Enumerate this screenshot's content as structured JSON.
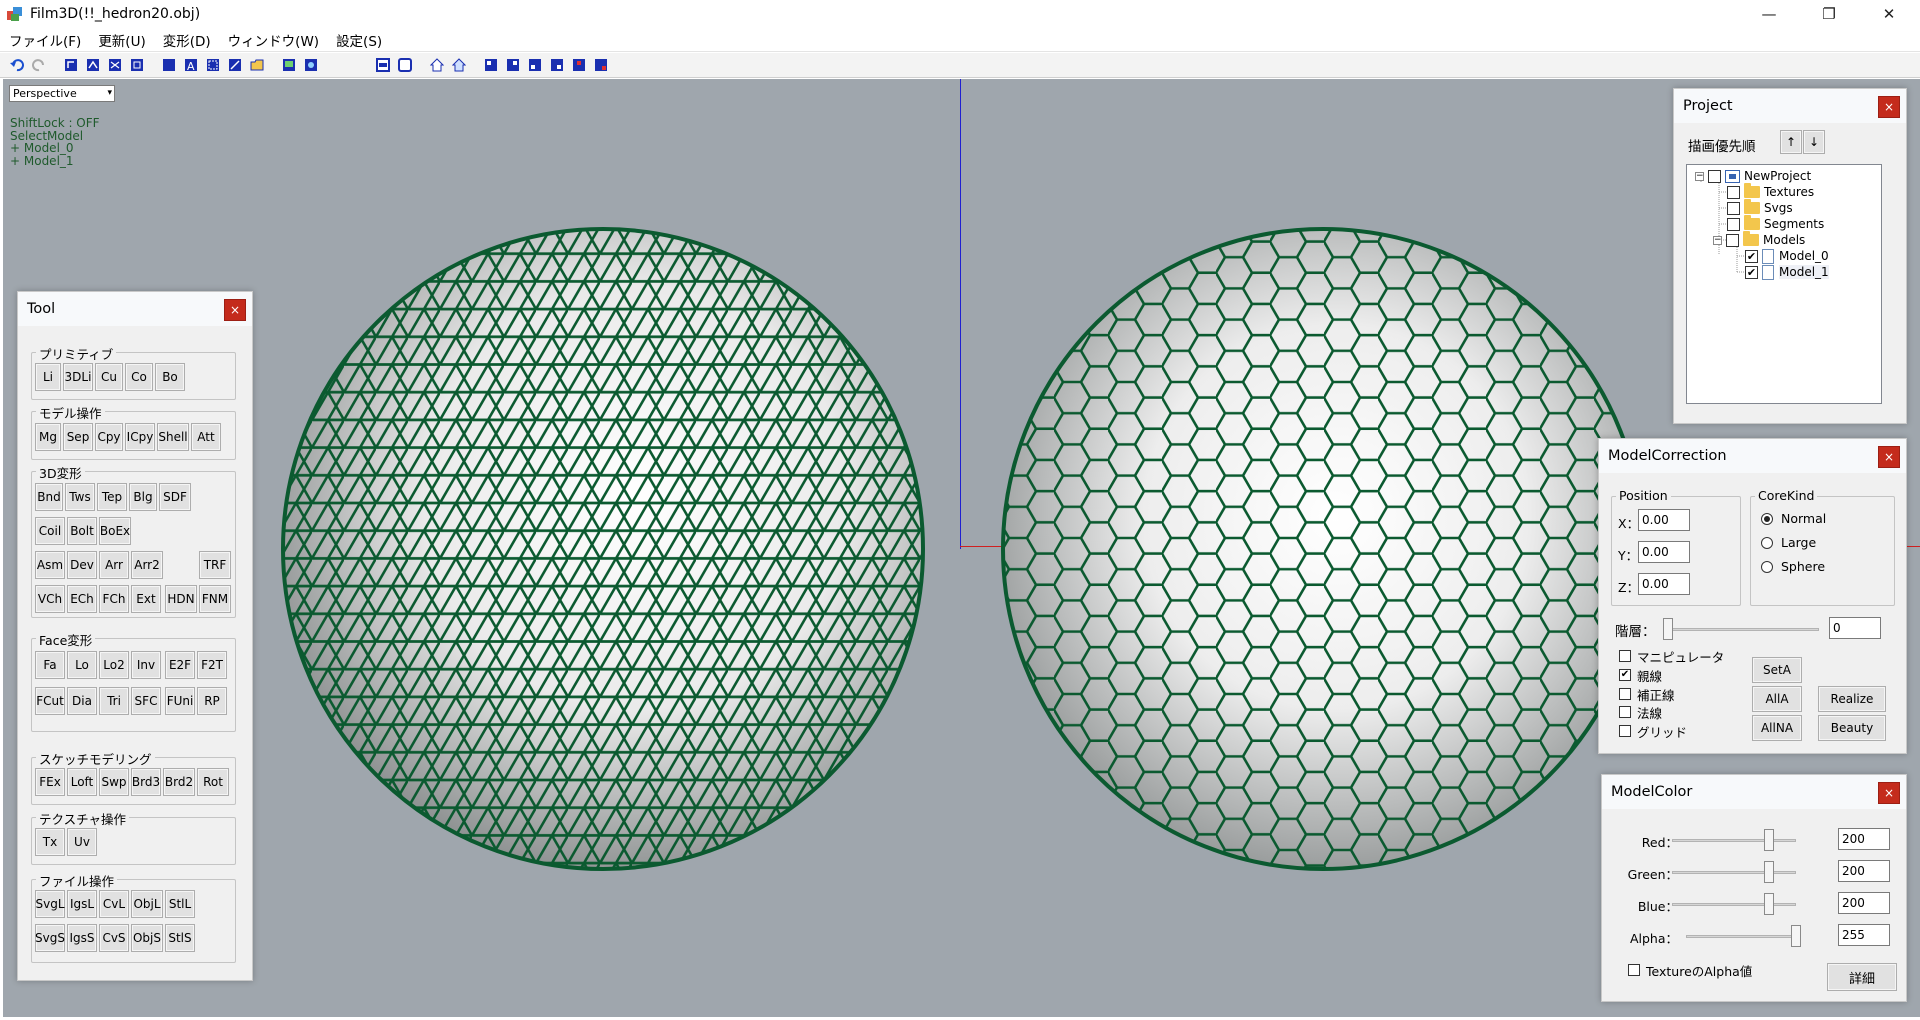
{
  "window": {
    "title": "Film3D(!!_hedron20.obj)",
    "controls": {
      "minimize": "—",
      "maximize": "❐",
      "close": "✕"
    }
  },
  "menu": [
    "ファイル(F)",
    "更新(U)",
    "変形(D)",
    "ウィンドウ(W)",
    "設定(S)"
  ],
  "viewport": {
    "view_mode": "Perspective",
    "status_lines": [
      "ShiftLock : OFF",
      "SelectModel",
      "+ Model_0",
      "+ Model_1"
    ]
  },
  "tool_panel": {
    "title": "Tool",
    "close": "×",
    "groups": [
      {
        "label": "プリミティブ",
        "buttons": [
          "Li",
          "3DLi",
          "Cu",
          "Co",
          "Bo"
        ]
      },
      {
        "label": "モデル操作",
        "buttons": [
          "Mg",
          "Sep",
          "Cpy",
          "ICpy",
          "Shell",
          "Att"
        ]
      },
      {
        "label": "3D変形",
        "rows": [
          [
            "Bnd",
            "Tws",
            "Tep",
            "Blg",
            "SDF"
          ],
          [
            "Coil",
            "Bolt",
            "BoEx"
          ],
          [
            "Asm",
            "Dev",
            "Arr",
            "Arr2",
            "TRF"
          ],
          [
            "VCh",
            "ECh",
            "FCh",
            "Ext",
            "HDN",
            "FNM"
          ]
        ]
      },
      {
        "label": "Face変形",
        "rows": [
          [
            "Fa",
            "Lo",
            "Lo2",
            "Inv",
            "E2F",
            "F2T"
          ],
          [
            "FCut",
            "Dia",
            "Tri",
            "SFC",
            "FUni",
            "RP"
          ]
        ]
      },
      {
        "label": "スケッチモデリング",
        "buttons": [
          "FEx",
          "Loft",
          "Swp",
          "Brd3",
          "Brd2",
          "Rot"
        ]
      },
      {
        "label": "テクスチャ操作",
        "buttons": [
          "Tx",
          "Uv"
        ]
      },
      {
        "label": "ファイル操作",
        "rows": [
          [
            "SvgL",
            "IgsL",
            "CvL",
            "ObjL",
            "StlL"
          ],
          [
            "SvgS",
            "IgsS",
            "CvS",
            "ObjS",
            "StlS"
          ]
        ]
      }
    ]
  },
  "project_panel": {
    "title": "Project",
    "close": "×",
    "order_label": "描画優先順",
    "up": "↑",
    "down": "↓",
    "tree": [
      {
        "label": "NewProject",
        "checked": false
      },
      {
        "label": "Textures",
        "checked": false
      },
      {
        "label": "Svgs",
        "checked": false
      },
      {
        "label": "Segments",
        "checked": false
      },
      {
        "label": "Models",
        "checked": false
      },
      {
        "label": "Model_0",
        "checked": true
      },
      {
        "label": "Model_1",
        "checked": true
      }
    ]
  },
  "model_correction": {
    "title": "ModelCorrection",
    "close": "×",
    "position_label": "Position",
    "x_label": "X：",
    "x": "0.00",
    "y_label": "Y：",
    "y": "0.00",
    "z_label": "Z：",
    "z": "0.00",
    "corekind_label": "CoreKind",
    "corekinds": [
      "Normal",
      "Large",
      "Sphere"
    ],
    "corekind_selected": "Normal",
    "layer_label": "階層：",
    "layer_value": "0",
    "layer_level": 0,
    "checks": [
      {
        "label": "マニピュレータ",
        "checked": false
      },
      {
        "label": "親線",
        "checked": true
      },
      {
        "label": "補正線",
        "checked": false
      },
      {
        "label": "法線",
        "checked": false
      },
      {
        "label": "グリッド",
        "checked": false
      }
    ],
    "buttons": {
      "seta": "SetA",
      "alla": "AllA",
      "allna": "AllNA",
      "realize": "Realize",
      "beauty": "Beauty"
    }
  },
  "model_color": {
    "title": "ModelColor",
    "close": "×",
    "channels": [
      {
        "label": "Red：",
        "value": "200",
        "level": 0.784
      },
      {
        "label": "Green：",
        "value": "200",
        "level": 0.784
      },
      {
        "label": "Blue：",
        "value": "200",
        "level": 0.784
      },
      {
        "label": "Alpha：",
        "value": "255",
        "level": 1.0
      }
    ],
    "texture_alpha_label": "TextureのAlpha値",
    "texture_alpha_checked": false,
    "detail_button": "詳細"
  },
  "colors": {
    "wire": "#0b5a30",
    "viewport_bg": "#9fa6ad",
    "close_red": "#c42b1c"
  }
}
